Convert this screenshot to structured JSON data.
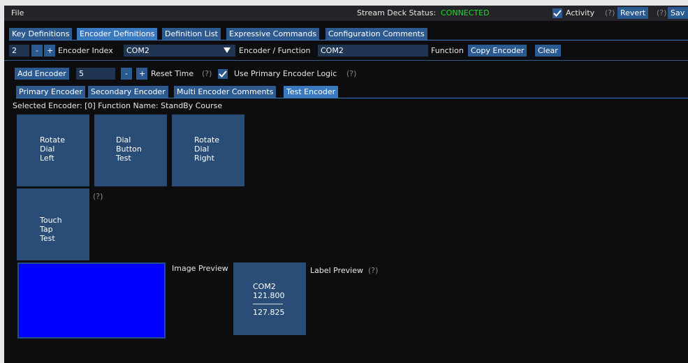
{
  "menu": {
    "file_label": "File"
  },
  "status": {
    "label": "Stream Deck Status:",
    "value": "CONNECTED",
    "value_color": "#1edc2c",
    "activity_label": "Activity",
    "activity_checked": true,
    "help": "(?)",
    "revert_label": "Revert",
    "save_label": "Sav"
  },
  "top_tabs": [
    {
      "label": "Key Definitions",
      "active": false
    },
    {
      "label": "Encoder Definitions",
      "active": true
    },
    {
      "label": "Definition List",
      "active": false
    },
    {
      "label": "Expressive Commands",
      "active": false
    },
    {
      "label": "Configuration Comments",
      "active": false
    }
  ],
  "encoder_row": {
    "index_value": "2",
    "minus": "-",
    "plus": "+",
    "index_label": "Encoder Index",
    "encoder_select": "COM2",
    "function_label": "Encoder / Function",
    "function_value": "COM2",
    "function_caption": "Function",
    "copy_label": "Copy Encoder",
    "clear_label": "Clear"
  },
  "add_row": {
    "add_label": "Add Encoder",
    "count_value": "5",
    "minus": "-",
    "plus": "+",
    "reset_label": "Reset Time",
    "help": "(?)",
    "primary_logic_label": "Use Primary Encoder Logic",
    "primary_logic_checked": true
  },
  "sub_tabs": [
    {
      "label": "Primary Encoder",
      "active": false
    },
    {
      "label": "Secondary Encoder",
      "active": false
    },
    {
      "label": "Multi Encoder Comments",
      "active": false
    },
    {
      "label": "Test Encoder",
      "active": true
    }
  ],
  "selected_text": "Selected Encoder: [0] Function Name: StandBy Course",
  "tiles": [
    {
      "lines": [
        "Rotate",
        "Dial",
        "Left"
      ]
    },
    {
      "lines": [
        "Dial",
        "Button",
        "Test"
      ]
    },
    {
      "lines": [
        "Rotate",
        "Dial",
        "Right"
      ]
    },
    {
      "lines": [
        "Touch",
        "Tap",
        "Test"
      ]
    }
  ],
  "touch_help": "(?)",
  "image_preview_label": "Image Preview",
  "image_preview_color": "#0000ff",
  "label_preview": {
    "caption": "Label Preview",
    "help": "(?)",
    "line1": "COM2",
    "line2": "121.800",
    "line3": "127.825"
  },
  "colors": {
    "accent": "#2a5a8f",
    "tab_active": "#3a78bf",
    "background": "#0d0d0f"
  }
}
